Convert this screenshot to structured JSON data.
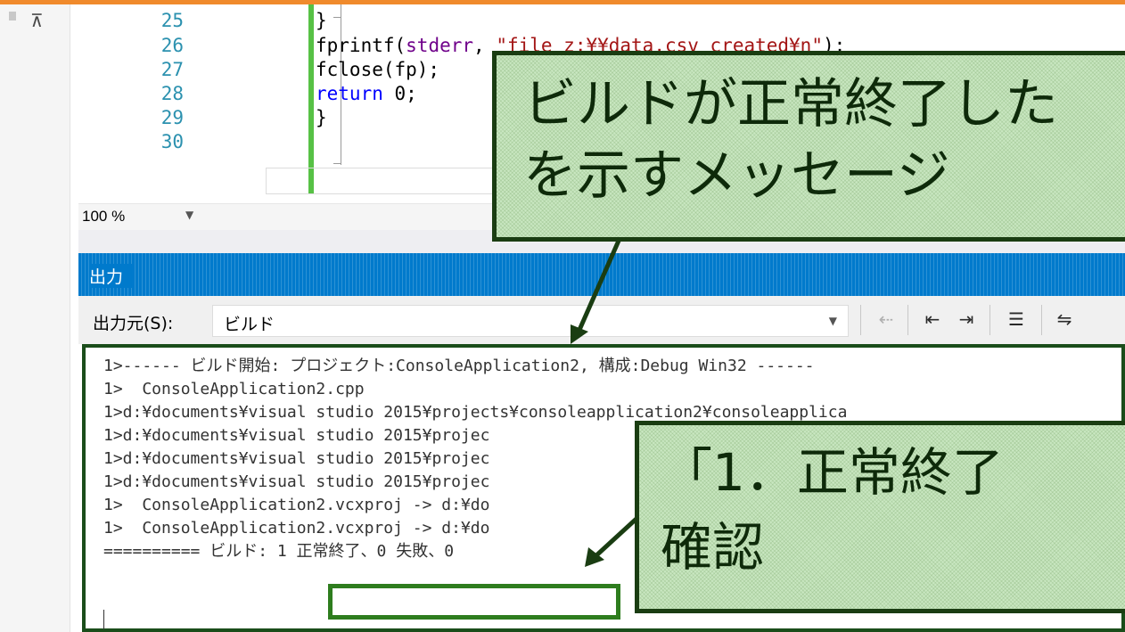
{
  "editor": {
    "lines": [
      {
        "no": "25",
        "segments": [
          {
            "text": "}",
            "cls": ""
          }
        ]
      },
      {
        "no": "26",
        "segments": [
          {
            "text": "fprintf(",
            "cls": ""
          },
          {
            "text": "stderr",
            "cls": "ident"
          },
          {
            "text": ", ",
            "cls": ""
          },
          {
            "text": "\"file z:¥¥data.csv created¥n\"",
            "cls": "str"
          },
          {
            "text": ");",
            "cls": ""
          }
        ]
      },
      {
        "no": "27",
        "segments": [
          {
            "text": "fclose(fp);",
            "cls": ""
          }
        ]
      },
      {
        "no": "28",
        "segments": [
          {
            "text": "return",
            "cls": "kw"
          },
          {
            "text": " 0;",
            "cls": ""
          }
        ]
      },
      {
        "no": "29",
        "segments": [
          {
            "text": "}",
            "cls": ""
          }
        ]
      },
      {
        "no": "30",
        "segments": []
      }
    ],
    "zoom": "100 %"
  },
  "output_panel": {
    "title": "出力",
    "source_label": "出力元(S):",
    "source_value": "ビルド",
    "lines": [
      "1>------ ビルド開始: プロジェクト:ConsoleApplication2, 構成:Debug Win32 ------",
      "1>  ConsoleApplication2.cpp",
      "1>d:¥documents¥visual studio 2015¥projects¥consoleapplication2¥consoleapplica",
      "1>d:¥documents¥visual studio 2015¥projec",
      "1>d:¥documents¥visual studio 2015¥projec",
      "1>d:¥documents¥visual studio 2015¥projec",
      "1>  ConsoleApplication2.vcxproj -> d:¥do",
      "1>  ConsoleApplication2.vcxproj -> d:¥do",
      "========== ビルド: 1 正常終了、0 失敗、0"
    ]
  },
  "callouts": {
    "build_message_line1": "ビルドが正常終了した",
    "build_message_line2": "を示すメッセージ",
    "confirm_line1": "「1．正常終了",
    "confirm_line2": "確認"
  },
  "colors": {
    "accent_orange": "#f08a2c",
    "panel_blue": "#007acc",
    "callout_fill": "#c9e7c1",
    "callout_border": "#1a3d12",
    "highlight_green": "#2e7d1e"
  }
}
